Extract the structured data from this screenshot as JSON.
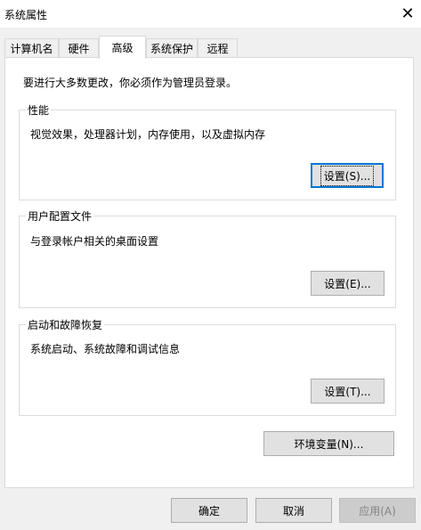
{
  "window": {
    "title": "系统属性"
  },
  "tabs": [
    {
      "label": "计算机名"
    },
    {
      "label": "硬件"
    },
    {
      "label": "高级"
    },
    {
      "label": "系统保护"
    },
    {
      "label": "远程"
    }
  ],
  "notice": "要进行大多数更改，你必须作为管理员登录。",
  "groups": {
    "performance": {
      "title": "性能",
      "desc": "视觉效果，处理器计划，内存使用，以及虚拟内存",
      "button": "设置(S)..."
    },
    "profile": {
      "title": "用户配置文件",
      "desc": "与登录帐户相关的桌面设置",
      "button": "设置(E)..."
    },
    "startup": {
      "title": "启动和故障恢复",
      "desc": "系统启动、系统故障和调试信息",
      "button": "设置(T)..."
    }
  },
  "env_button": "环境变量(N)...",
  "footer": {
    "ok": "确定",
    "cancel": "取消",
    "apply": "应用(A)"
  }
}
